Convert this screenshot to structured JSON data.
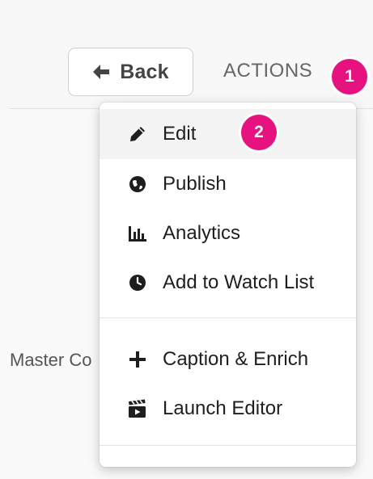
{
  "header": {
    "back_label": "Back",
    "actions_label": "ACTIONS",
    "badge_1": "1",
    "badge_2": "2"
  },
  "background": {
    "master_text": "Master Co"
  },
  "menu": {
    "items": [
      {
        "label": "Edit",
        "icon": "pencil-icon"
      },
      {
        "label": "Publish",
        "icon": "globe-icon"
      },
      {
        "label": "Analytics",
        "icon": "bar-chart-icon"
      },
      {
        "label": "Add to Watch List",
        "icon": "clock-icon"
      },
      {
        "label": "Caption & Enrich",
        "icon": "plus-icon"
      },
      {
        "label": "Launch Editor",
        "icon": "clapperboard-icon"
      }
    ]
  },
  "colors": {
    "accent_badge": "#e6127f",
    "highlight_row": "#f3f3f3",
    "text_dark": "#1e1e1e",
    "text_muted": "#666666"
  }
}
